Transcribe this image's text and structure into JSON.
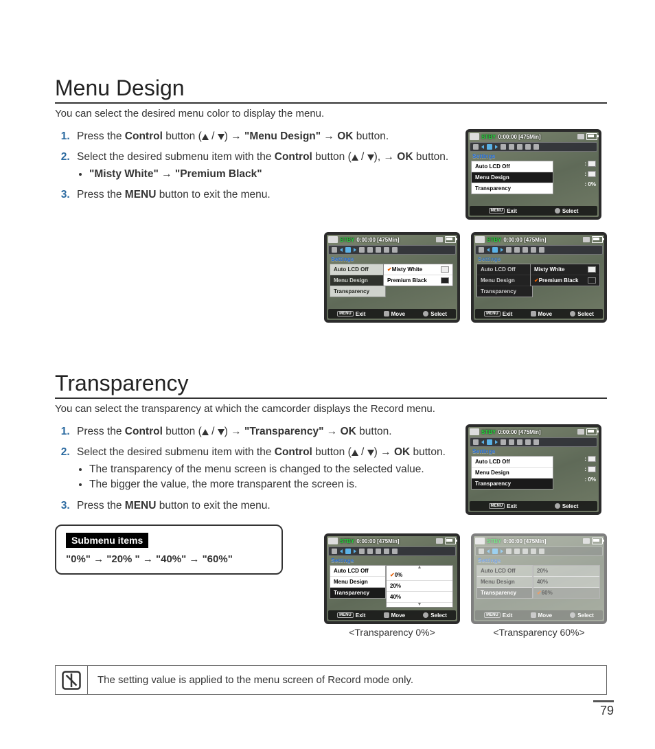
{
  "page_number": "79",
  "section1": {
    "heading": "Menu Design",
    "intro": "You can select the desired menu color to display the menu.",
    "step1_a": "Press the ",
    "step1_b": " button (",
    "step1_c": ") → ",
    "step1_d": " → ",
    "step1_e": " button.",
    "step1_control": "Control",
    "step1_target": "\"Menu Design\"",
    "step1_ok": "OK",
    "step2_a": "Select the desired submenu item with the ",
    "step2_b": " button (",
    "step2_c": "), → ",
    "step2_d": " button.",
    "step2_control": "Control",
    "step2_ok": "OK",
    "step2_bullet": "\"Misty White\" → \"Premium Black\"",
    "step3_a": "Press the ",
    "step3_b": " button to exit the menu.",
    "step3_menu": "MENU"
  },
  "section2": {
    "heading": "Transparency",
    "intro": "You can select the transparency at which the camcorder displays the Record menu.",
    "step1_a": "Press the ",
    "step1_b": " button (",
    "step1_c": ") → ",
    "step1_d": " → ",
    "step1_e": " button.",
    "step1_control": "Control",
    "step1_target": "\"Transparency\"",
    "step1_ok": "OK",
    "step2_a": "Select the desired submenu item with the ",
    "step2_b": " button (",
    "step2_c": ") → ",
    "step2_d": " button.",
    "step2_control": "Control",
    "step2_ok": "OK",
    "step2_bullet1": "The transparency of the menu screen is changed to the selected value.",
    "step2_bullet2": "The bigger the value, the more transparent the screen is.",
    "step3_a": "Press the ",
    "step3_b": " button to exit the menu.",
    "step3_menu": "MENU",
    "submenu_title": "Submenu items",
    "submenu_items": "\"0%\" → \"20% \" → \"40%\" → \"60%\"",
    "caption_left": "<Transparency 0%>",
    "caption_right": "<Transparency 60%>"
  },
  "note": "The setting value is applied to the menu screen of Record mode only.",
  "lcd": {
    "stby": "STBY",
    "time": "0:00:00 [475Min]",
    "settings": "Settings",
    "item_auto": "Auto LCD Off",
    "item_menu": "Menu Design",
    "item_trans": "Transparency",
    "val_zero": ": 0%",
    "sub_misty": "Misty White",
    "sub_premium": "Premium Black",
    "opt_0": "0%",
    "opt_20": "20%",
    "opt_40": "40%",
    "opt_60": "60%",
    "bb_exit": "Exit",
    "bb_select": "Select",
    "bb_move": "Move",
    "bb_menu": "MENU"
  }
}
